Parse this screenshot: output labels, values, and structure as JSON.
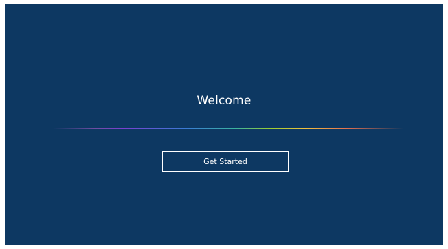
{
  "welcome": {
    "title": "Welcome",
    "button_label": "Get Started"
  },
  "colors": {
    "background": "#0d3862",
    "text": "#ffffff",
    "button_border": "#ffffff"
  }
}
